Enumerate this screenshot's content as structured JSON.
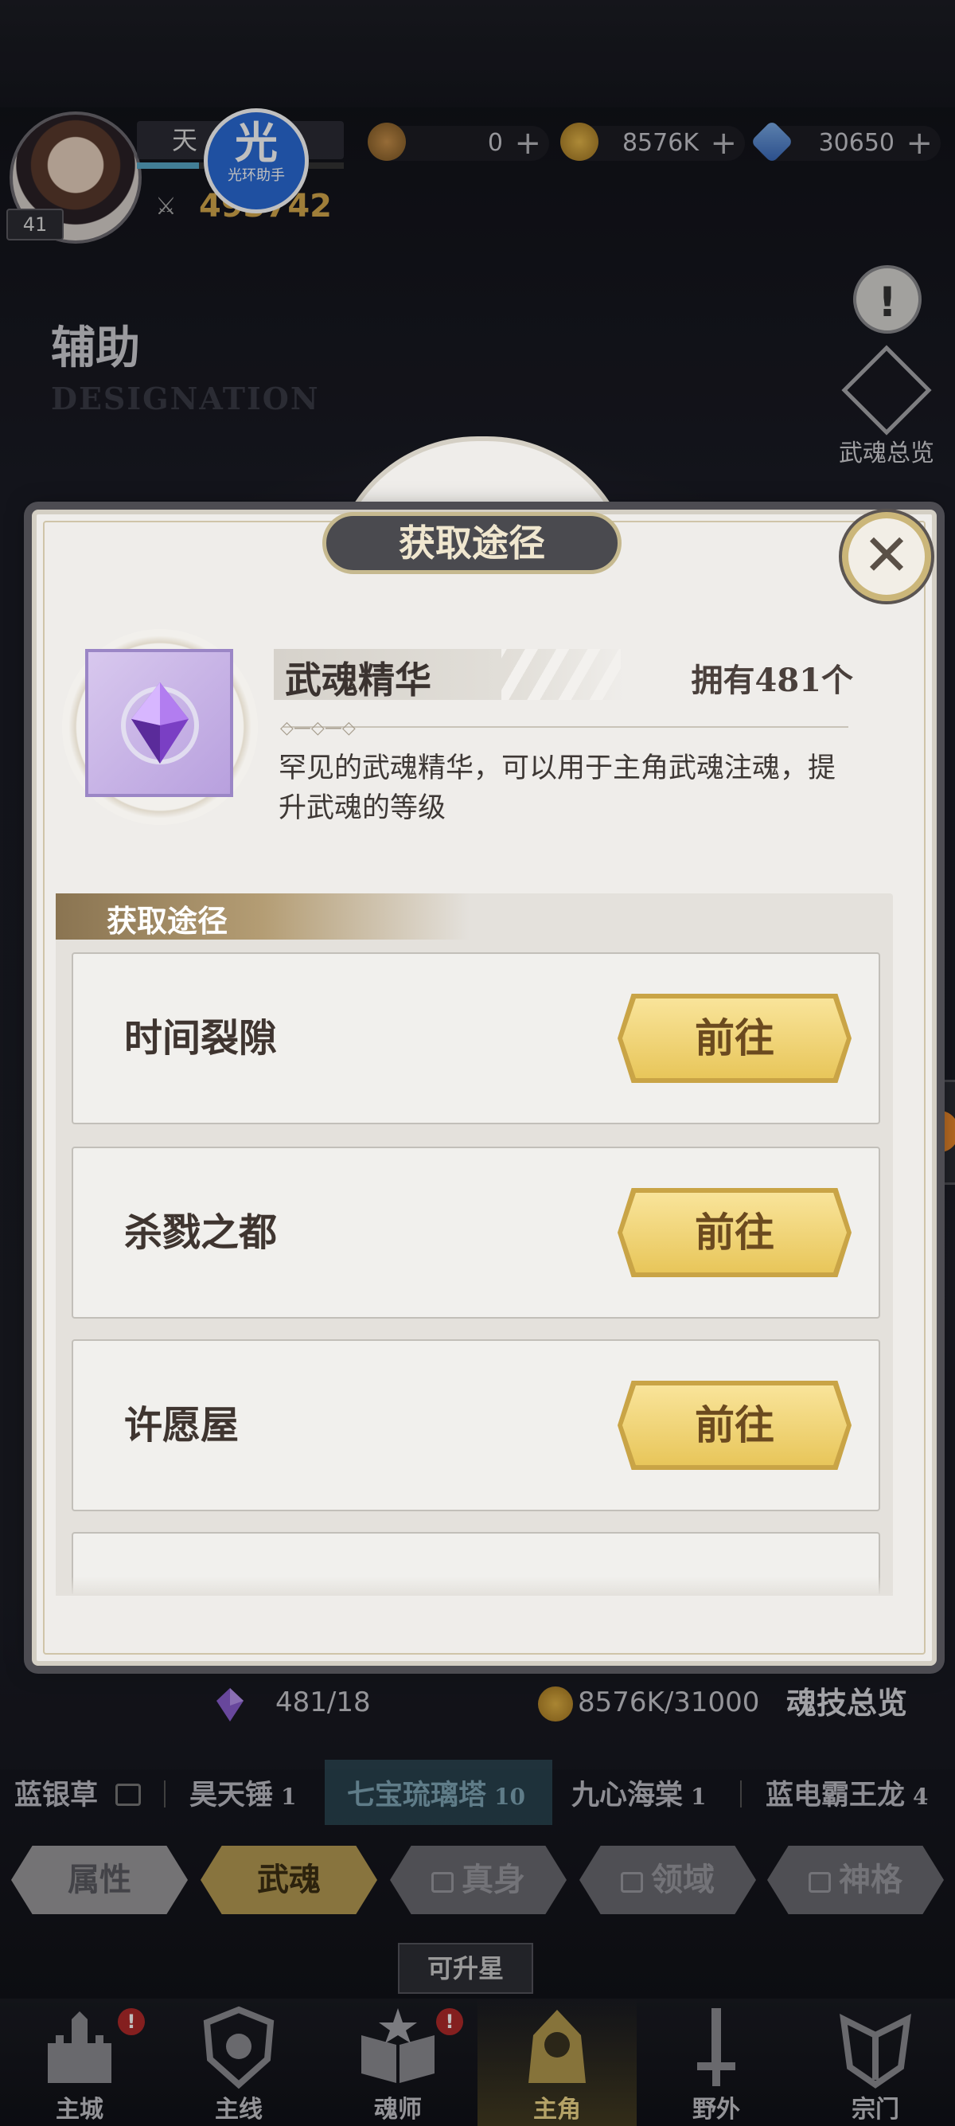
{
  "header": {
    "player_name": "天",
    "level": "41",
    "power": "493742",
    "watermark": {
      "glyph": "光",
      "text": "光环助手"
    },
    "currencies": [
      {
        "name": "currency-a",
        "value": "0",
        "icon": "bronze-coin-icon"
      },
      {
        "name": "gold",
        "value": "8576K",
        "icon": "gold-coin-icon"
      },
      {
        "name": "diamond",
        "value": "30650",
        "icon": "diamond-icon"
      }
    ],
    "alert_glyph": "!"
  },
  "page": {
    "title": "辅助",
    "subtitle": "DESIGNATION",
    "overview_label": "武魂总览"
  },
  "dialog": {
    "title": "获取途径",
    "close_glyph": "✕",
    "item": {
      "name": "武魂精华",
      "owned": "拥有481个",
      "description": "罕见的武魂精华，可以用于主角武魂注魂，提升武魂的等级"
    },
    "sources_title": "获取途径",
    "sources": [
      {
        "label": "时间裂隙",
        "button": "前往"
      },
      {
        "label": "杀戮之都",
        "button": "前往"
      },
      {
        "label": "许愿屋",
        "button": "前往"
      }
    ]
  },
  "resources": {
    "essence": "481/18",
    "gold": "8576K/31000",
    "skill_overview": "魂技总览"
  },
  "souls": [
    {
      "name": "蓝银草",
      "count": "",
      "locked": true
    },
    {
      "name": "昊天锤",
      "count": "1",
      "locked": false
    },
    {
      "name": "七宝琉璃塔",
      "count": "10",
      "locked": false,
      "selected": true
    },
    {
      "name": "九心海棠",
      "count": "1",
      "locked": false
    },
    {
      "name": "蓝电霸王龙",
      "count": "4",
      "locked": false
    }
  ],
  "tabs": [
    {
      "label": "属性",
      "state": "normal"
    },
    {
      "label": "武魂",
      "state": "active"
    },
    {
      "label": "真身",
      "state": "locked"
    },
    {
      "label": "领域",
      "state": "locked"
    },
    {
      "label": "神格",
      "state": "locked"
    }
  ],
  "can_star_label": "可升星",
  "nav": [
    {
      "label": "主城",
      "badge": "!"
    },
    {
      "label": "主线",
      "badge": ""
    },
    {
      "label": "魂师",
      "badge": "!"
    },
    {
      "label": "主角",
      "badge": "",
      "active": true
    },
    {
      "label": "野外",
      "badge": ""
    },
    {
      "label": "宗门",
      "badge": ""
    }
  ],
  "colors": {
    "accent_gold": "#e8c65a",
    "dialog_bg": "#efedea",
    "title_pill": "#4a4a4f",
    "text_dark": "#3f3530"
  }
}
